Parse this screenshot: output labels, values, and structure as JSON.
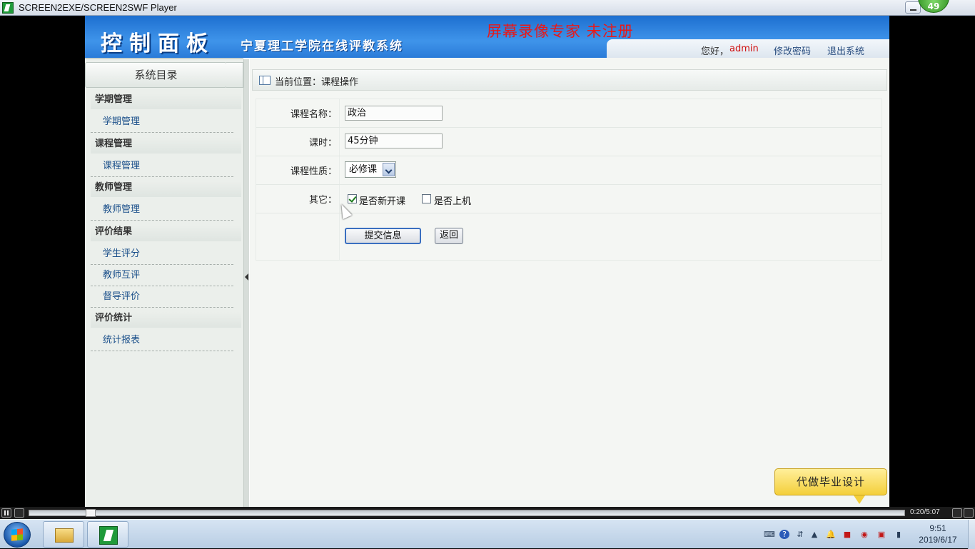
{
  "window": {
    "title": "SCREEN2EXE/SCREEN2SWF Player",
    "badge": "49"
  },
  "header": {
    "brand": "控制面板",
    "system_name": "宁夏理工学院在线评教系统",
    "watermark": "屏幕录像专家  未注册",
    "greeting": "您好，",
    "username": "admin",
    "change_password": "修改密码",
    "logout": "退出系统"
  },
  "sidebar": {
    "title": "系统目录",
    "groups": [
      {
        "label": "学期管理",
        "items": [
          "学期管理"
        ]
      },
      {
        "label": "课程管理",
        "items": [
          "课程管理"
        ]
      },
      {
        "label": "教师管理",
        "items": [
          "教师管理"
        ]
      },
      {
        "label": "评价结果",
        "items": [
          "学生评分",
          "教师互评",
          "督导评价"
        ]
      },
      {
        "label": "评价统计",
        "items": [
          "统计报表"
        ]
      }
    ]
  },
  "breadcrumb": {
    "text": "当前位置：课程操作"
  },
  "form": {
    "course_name_label": "课程名称：",
    "course_name_value": "政治",
    "hours_label": "课时：",
    "hours_value": "45分钟",
    "type_label": "课程性质：",
    "type_value": "必修课",
    "other_label": "其它：",
    "new_course_label": "是否新开课",
    "new_course_checked": true,
    "lab_label": "是否上机",
    "lab_checked": false,
    "submit_label": "提交信息",
    "back_label": "返回"
  },
  "promo": {
    "text": "代做毕业设计"
  },
  "player": {
    "time": "0:20/5:07",
    "progress": 0.065
  },
  "taskbar": {
    "time": "9:51",
    "date": "2019/6/17"
  }
}
